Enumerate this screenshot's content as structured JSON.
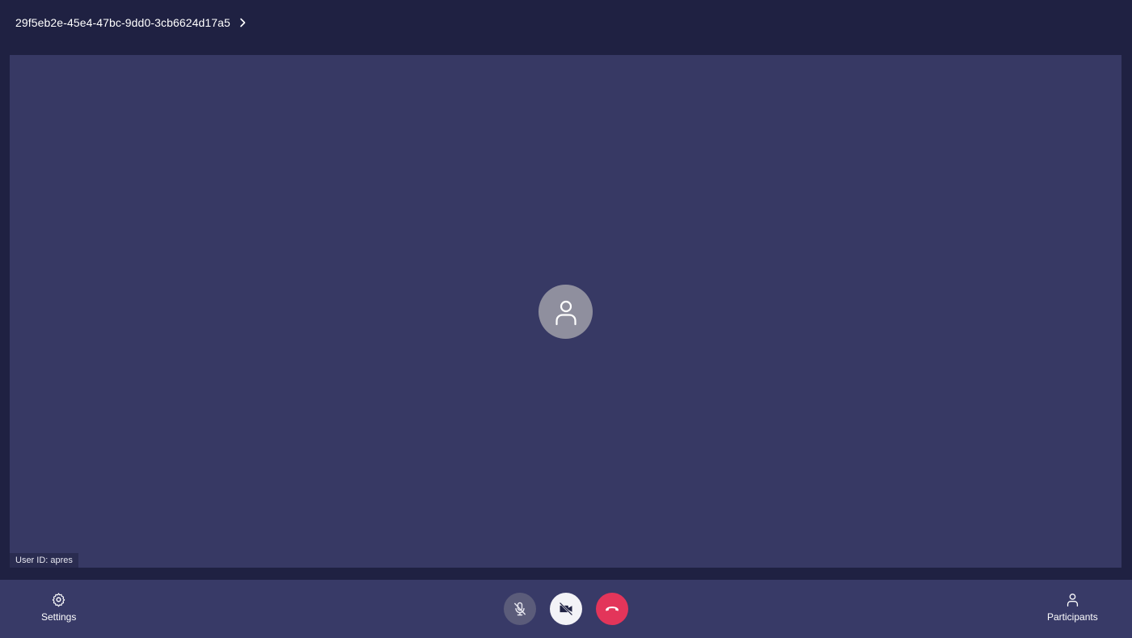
{
  "header": {
    "meeting_id": "29f5eb2e-45e4-47bc-9dd0-3cb6624d17a5"
  },
  "stage": {
    "avatar_icon": "person-icon",
    "user_tag": "User ID: apres"
  },
  "toolbar": {
    "settings_label": "Settings",
    "participants_label": "Participants",
    "mic_state": "muted",
    "camera_state": "off",
    "colors": {
      "hangup": "#e3355a",
      "background": "#383a67"
    }
  }
}
